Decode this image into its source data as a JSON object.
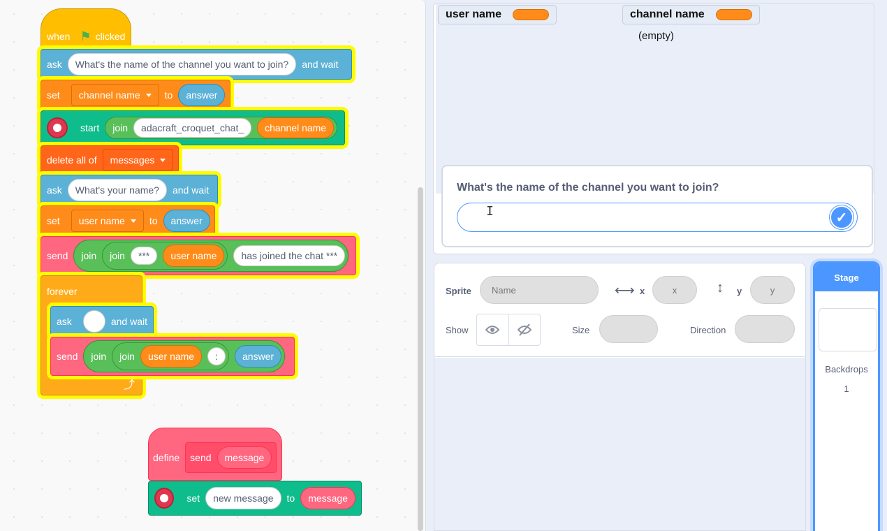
{
  "blocks": {
    "hat": {
      "when": "when",
      "clicked": "clicked"
    },
    "ask1": {
      "ask": "ask",
      "question": "What's the name of the channel you want to join?",
      "wait": "and wait"
    },
    "set1": {
      "set": "set",
      "var": "channel name",
      "to": "to",
      "value": "answer"
    },
    "start": {
      "start": "start",
      "join": "join",
      "prefix": "adacraft_croquet_chat_",
      "var": "channel name"
    },
    "delete": {
      "label": "delete all of",
      "list": "messages"
    },
    "ask2": {
      "ask": "ask",
      "question": "What's your name?",
      "wait": "and wait"
    },
    "set2": {
      "set": "set",
      "var": "user name",
      "to": "to",
      "value": "answer"
    },
    "send1": {
      "send": "send",
      "join1": "join",
      "join2": "join",
      "stars": "***",
      "var": "user name",
      "suffix": "has joined the chat ***"
    },
    "forever": {
      "label": "forever"
    },
    "ask3": {
      "ask": "ask",
      "question": "",
      "wait": "and wait"
    },
    "send2": {
      "send": "send",
      "join1": "join",
      "join2": "join",
      "var": "user name",
      "sep": ":",
      "value": "answer"
    },
    "define": {
      "define": "define",
      "send": "send",
      "param": "message"
    },
    "set3": {
      "set": "set",
      "var": "new message",
      "to": "to",
      "value": "message"
    }
  },
  "stage": {
    "monitors": [
      {
        "label": "user name"
      },
      {
        "label": "channel name"
      }
    ],
    "empty": "(empty)",
    "prompt": {
      "question": "What's the name of the channel you want to join?",
      "value": ""
    }
  },
  "sprite_info": {
    "sprite_label": "Sprite",
    "name_placeholder": "Name",
    "x_label": "x",
    "x_placeholder": "x",
    "y_label": "y",
    "y_placeholder": "y",
    "show_label": "Show",
    "size_label": "Size",
    "direction_label": "Direction"
  },
  "stage_selector": {
    "header": "Stage",
    "backdrops_label": "Backdrops",
    "backdrops_count": "1"
  },
  "colors": {
    "events": "#ffbf00",
    "sensing": "#5cb1d6",
    "variables": "#ff8c1a",
    "extension": "#0fbd8c",
    "operators": "#59c059",
    "my_blocks": "#ff6680",
    "control": "#ffab19",
    "highlight": "#fffb00",
    "accent": "#4c97ff"
  }
}
